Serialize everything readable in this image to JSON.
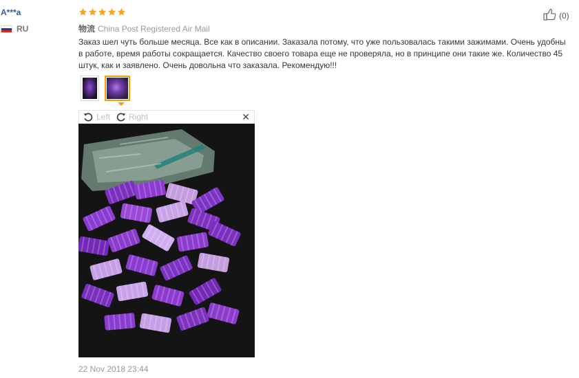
{
  "buyer": {
    "name": "A***a",
    "country": "RU",
    "flag_colors": [
      "#ffffff",
      "#1c3ea0",
      "#d52b1e"
    ]
  },
  "review": {
    "rating": 5,
    "star_color": "#f5a623",
    "shipping_label": "物流",
    "shipping_method": "China Post Registered Air Mail",
    "text": "Заказ шел чуть больше месяца. Все как в описании. Заказала потому, что уже пользовалась такими зажимами. Очень удобны в работе, время работы сокращается. Качество своего товара еще не проверяла, но в принципе они такие же. Количество 45 штук, как и заявлено. Очень довольна что заказала. Рекомендую!!!",
    "helpful_icon": "thumbs-up-icon",
    "helpful_count": "(0)",
    "date": "22 Nov 2018 23:44"
  },
  "gallery": {
    "thumbnail_count": 2,
    "active_index": 1,
    "accent_color": "#f39c12"
  },
  "viewer": {
    "rotate_left_label": "Left",
    "rotate_right_label": "Right",
    "close_icon": "close-icon"
  }
}
